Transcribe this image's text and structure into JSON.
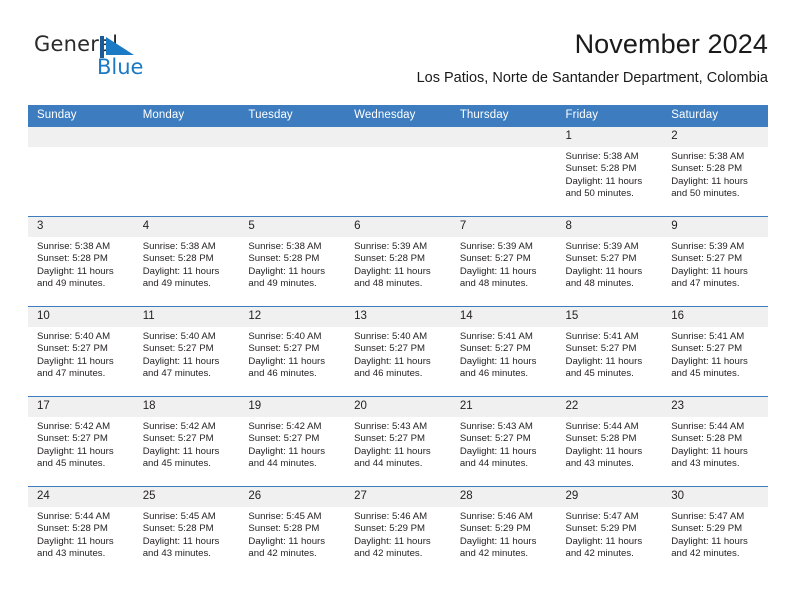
{
  "logo": {
    "word1": "General",
    "word2": "Blue",
    "mark": "blue-triangle-flag-icon",
    "brand_color": "#1a7ac4"
  },
  "header": {
    "title": "November 2024",
    "subtitle": "Los Patios, Norte de Santander Department, Colombia"
  },
  "colors": {
    "header_blue": "#3c7cbf",
    "daynum_band": "#f0f0f0",
    "text": "#231f20"
  },
  "calendar": {
    "weekday_headers": [
      "Sunday",
      "Monday",
      "Tuesday",
      "Wednesday",
      "Thursday",
      "Friday",
      "Saturday"
    ],
    "weeks": [
      [
        {
          "day": "",
          "lines": []
        },
        {
          "day": "",
          "lines": []
        },
        {
          "day": "",
          "lines": []
        },
        {
          "day": "",
          "lines": []
        },
        {
          "day": "",
          "lines": []
        },
        {
          "day": "1",
          "lines": [
            "Sunrise: 5:38 AM",
            "Sunset: 5:28 PM",
            "Daylight: 11 hours and 50 minutes."
          ]
        },
        {
          "day": "2",
          "lines": [
            "Sunrise: 5:38 AM",
            "Sunset: 5:28 PM",
            "Daylight: 11 hours and 50 minutes."
          ]
        }
      ],
      [
        {
          "day": "3",
          "lines": [
            "Sunrise: 5:38 AM",
            "Sunset: 5:28 PM",
            "Daylight: 11 hours and 49 minutes."
          ]
        },
        {
          "day": "4",
          "lines": [
            "Sunrise: 5:38 AM",
            "Sunset: 5:28 PM",
            "Daylight: 11 hours and 49 minutes."
          ]
        },
        {
          "day": "5",
          "lines": [
            "Sunrise: 5:38 AM",
            "Sunset: 5:28 PM",
            "Daylight: 11 hours and 49 minutes."
          ]
        },
        {
          "day": "6",
          "lines": [
            "Sunrise: 5:39 AM",
            "Sunset: 5:28 PM",
            "Daylight: 11 hours and 48 minutes."
          ]
        },
        {
          "day": "7",
          "lines": [
            "Sunrise: 5:39 AM",
            "Sunset: 5:27 PM",
            "Daylight: 11 hours and 48 minutes."
          ]
        },
        {
          "day": "8",
          "lines": [
            "Sunrise: 5:39 AM",
            "Sunset: 5:27 PM",
            "Daylight: 11 hours and 48 minutes."
          ]
        },
        {
          "day": "9",
          "lines": [
            "Sunrise: 5:39 AM",
            "Sunset: 5:27 PM",
            "Daylight: 11 hours and 47 minutes."
          ]
        }
      ],
      [
        {
          "day": "10",
          "lines": [
            "Sunrise: 5:40 AM",
            "Sunset: 5:27 PM",
            "Daylight: 11 hours and 47 minutes."
          ]
        },
        {
          "day": "11",
          "lines": [
            "Sunrise: 5:40 AM",
            "Sunset: 5:27 PM",
            "Daylight: 11 hours and 47 minutes."
          ]
        },
        {
          "day": "12",
          "lines": [
            "Sunrise: 5:40 AM",
            "Sunset: 5:27 PM",
            "Daylight: 11 hours and 46 minutes."
          ]
        },
        {
          "day": "13",
          "lines": [
            "Sunrise: 5:40 AM",
            "Sunset: 5:27 PM",
            "Daylight: 11 hours and 46 minutes."
          ]
        },
        {
          "day": "14",
          "lines": [
            "Sunrise: 5:41 AM",
            "Sunset: 5:27 PM",
            "Daylight: 11 hours and 46 minutes."
          ]
        },
        {
          "day": "15",
          "lines": [
            "Sunrise: 5:41 AM",
            "Sunset: 5:27 PM",
            "Daylight: 11 hours and 45 minutes."
          ]
        },
        {
          "day": "16",
          "lines": [
            "Sunrise: 5:41 AM",
            "Sunset: 5:27 PM",
            "Daylight: 11 hours and 45 minutes."
          ]
        }
      ],
      [
        {
          "day": "17",
          "lines": [
            "Sunrise: 5:42 AM",
            "Sunset: 5:27 PM",
            "Daylight: 11 hours and 45 minutes."
          ]
        },
        {
          "day": "18",
          "lines": [
            "Sunrise: 5:42 AM",
            "Sunset: 5:27 PM",
            "Daylight: 11 hours and 45 minutes."
          ]
        },
        {
          "day": "19",
          "lines": [
            "Sunrise: 5:42 AM",
            "Sunset: 5:27 PM",
            "Daylight: 11 hours and 44 minutes."
          ]
        },
        {
          "day": "20",
          "lines": [
            "Sunrise: 5:43 AM",
            "Sunset: 5:27 PM",
            "Daylight: 11 hours and 44 minutes."
          ]
        },
        {
          "day": "21",
          "lines": [
            "Sunrise: 5:43 AM",
            "Sunset: 5:27 PM",
            "Daylight: 11 hours and 44 minutes."
          ]
        },
        {
          "day": "22",
          "lines": [
            "Sunrise: 5:44 AM",
            "Sunset: 5:28 PM",
            "Daylight: 11 hours and 43 minutes."
          ]
        },
        {
          "day": "23",
          "lines": [
            "Sunrise: 5:44 AM",
            "Sunset: 5:28 PM",
            "Daylight: 11 hours and 43 minutes."
          ]
        }
      ],
      [
        {
          "day": "24",
          "lines": [
            "Sunrise: 5:44 AM",
            "Sunset: 5:28 PM",
            "Daylight: 11 hours and 43 minutes."
          ]
        },
        {
          "day": "25",
          "lines": [
            "Sunrise: 5:45 AM",
            "Sunset: 5:28 PM",
            "Daylight: 11 hours and 43 minutes."
          ]
        },
        {
          "day": "26",
          "lines": [
            "Sunrise: 5:45 AM",
            "Sunset: 5:28 PM",
            "Daylight: 11 hours and 42 minutes."
          ]
        },
        {
          "day": "27",
          "lines": [
            "Sunrise: 5:46 AM",
            "Sunset: 5:29 PM",
            "Daylight: 11 hours and 42 minutes."
          ]
        },
        {
          "day": "28",
          "lines": [
            "Sunrise: 5:46 AM",
            "Sunset: 5:29 PM",
            "Daylight: 11 hours and 42 minutes."
          ]
        },
        {
          "day": "29",
          "lines": [
            "Sunrise: 5:47 AM",
            "Sunset: 5:29 PM",
            "Daylight: 11 hours and 42 minutes."
          ]
        },
        {
          "day": "30",
          "lines": [
            "Sunrise: 5:47 AM",
            "Sunset: 5:29 PM",
            "Daylight: 11 hours and 42 minutes."
          ]
        }
      ]
    ]
  }
}
